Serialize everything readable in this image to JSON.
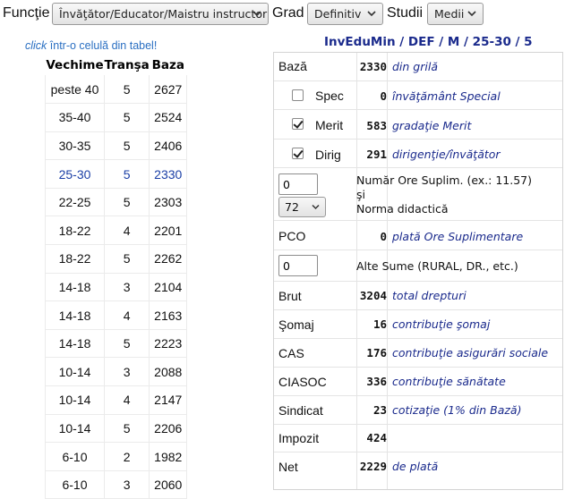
{
  "topbar": {
    "functie_label": "Funcţie",
    "functie_value": "Învăţător/Educator/Maistru instructor",
    "grad_label": "Grad",
    "grad_value": "Definitiv",
    "studii_label": "Studii",
    "studii_value": "Medii"
  },
  "hint": {
    "click_word": "click",
    "rest": " într-o celulă din tabel!"
  },
  "table": {
    "headers": [
      "Vechime",
      "Tranşa",
      "Baza"
    ],
    "rows": [
      [
        "peste 40",
        "5",
        "2627"
      ],
      [
        "35-40",
        "5",
        "2524"
      ],
      [
        "30-35",
        "5",
        "2406"
      ],
      [
        "25-30",
        "5",
        "2330"
      ],
      [
        "22-25",
        "5",
        "2303"
      ],
      [
        "18-22",
        "4",
        "2201"
      ],
      [
        "18-22",
        "5",
        "2262"
      ],
      [
        "14-18",
        "3",
        "2104"
      ],
      [
        "14-18",
        "4",
        "2163"
      ],
      [
        "14-18",
        "5",
        "2223"
      ],
      [
        "10-14",
        "3",
        "2088"
      ],
      [
        "10-14",
        "4",
        "2147"
      ],
      [
        "10-14",
        "5",
        "2206"
      ],
      [
        "6-10",
        "2",
        "1982"
      ],
      [
        "6-10",
        "3",
        "2060"
      ]
    ],
    "selected_row_index": 3
  },
  "right": {
    "header": "InvEduMin / DEF / M / 25-30 / 5",
    "baza": {
      "name": "Bază",
      "value": "2330",
      "desc": "din grilă"
    },
    "spec": {
      "name": "Spec",
      "value": "0",
      "desc": "învăţământ Special",
      "checked": false
    },
    "merit": {
      "name": "Merit",
      "value": "583",
      "desc": "gradaţie Merit",
      "checked": true
    },
    "dirig": {
      "name": "Dirig",
      "value": "291",
      "desc": "dirigenţie/învăţător",
      "checked": true
    },
    "ore": {
      "input_value": "0",
      "norma_value": "72",
      "note_line1": "Număr Ore Suplim. (ex.: 11.57)",
      "note_line2": "şi",
      "note_line3": "Norma didactică"
    },
    "pco": {
      "name": "PCO",
      "value": "0",
      "desc": "plată Ore Suplimentare"
    },
    "alte": {
      "input_value": "0",
      "note": "Alte Sume (RURAL, DR., etc.)"
    },
    "brut": {
      "name": "Brut",
      "value": "3204",
      "desc": "total drepturi"
    },
    "somaj": {
      "name": "Şomaj",
      "value": "16",
      "desc": "contribuţie şomaj"
    },
    "cas": {
      "name": "CAS",
      "value": "176",
      "desc": "contribuţie asigurări sociale"
    },
    "ciasoc": {
      "name": "CIASOC",
      "value": "336",
      "desc": "contribuţie sănătate"
    },
    "sindicat": {
      "name": "Sindicat",
      "value": "23",
      "desc": "cotizaţie (1% din Bază)"
    },
    "impozit": {
      "name": "Impozit",
      "value": "424",
      "desc": ""
    },
    "net": {
      "name": "Net",
      "value": "2229",
      "desc": "de plată"
    }
  }
}
